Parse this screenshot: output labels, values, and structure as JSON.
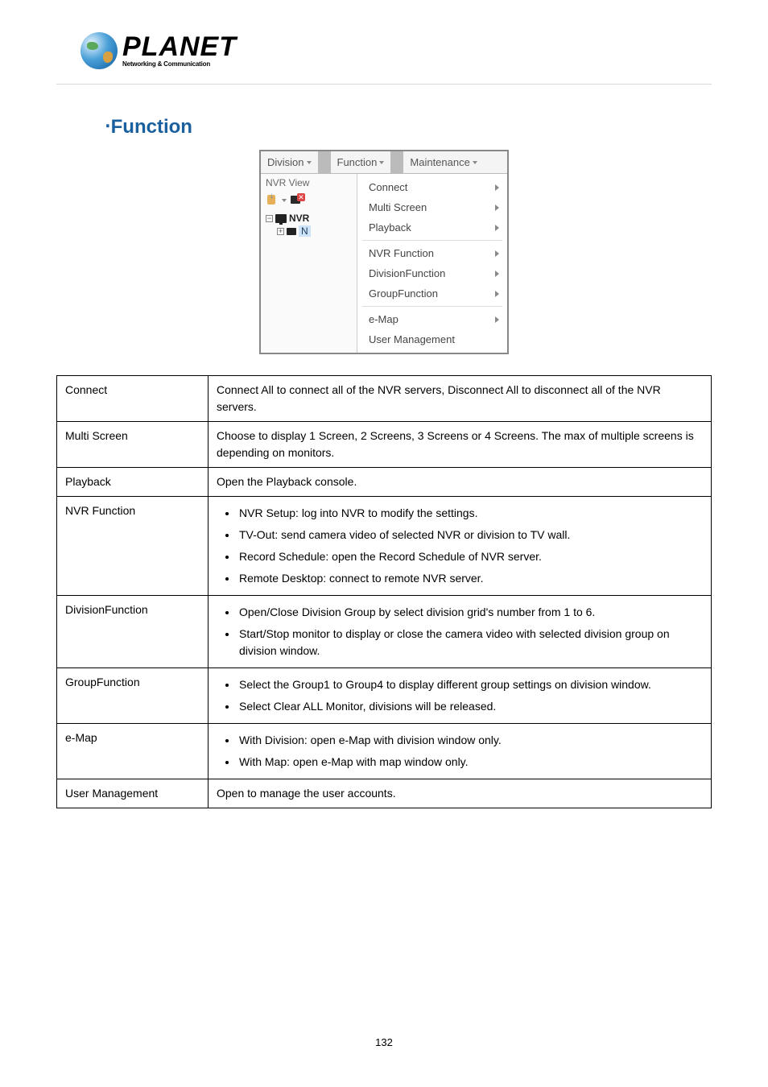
{
  "logo": {
    "brand": "PLANET",
    "tagline": "Networking & Communication"
  },
  "section_title": "‧Function",
  "screenshot": {
    "menubar": {
      "division": "Division",
      "function": "Function",
      "maintenance": "Maintenance"
    },
    "sidebar": {
      "view_label": "NVR View",
      "nvr_root": "NVR",
      "nvr_child_prefix": "N"
    },
    "menu": {
      "connect": "Connect",
      "multi_screen": "Multi Screen",
      "playback": "Playback",
      "nvr_function": "NVR Function",
      "division_function": "DivisionFunction",
      "group_function": "GroupFunction",
      "emap": "e-Map",
      "user_management": "User Management"
    }
  },
  "table": {
    "rows": [
      {
        "label": "Connect",
        "desc": "Connect All to connect all of the NVR servers, Disconnect All to disconnect all of the NVR servers.",
        "list": null
      },
      {
        "label": "Multi Screen",
        "desc": "Choose to display 1 Screen, 2 Screens, 3 Screens or 4 Screens. The max of multiple screens is depending on monitors.",
        "list": null
      },
      {
        "label": "Playback",
        "desc": "Open the Playback console.",
        "list": null
      },
      {
        "label": "NVR Function",
        "desc": null,
        "list": [
          "NVR Setup: log into NVR to modify the settings.",
          "TV-Out: send camera video of selected NVR or division to TV wall.",
          "Record Schedule: open the Record Schedule of NVR server.",
          "Remote Desktop: connect to remote NVR server."
        ]
      },
      {
        "label": "DivisionFunction",
        "desc": null,
        "list": [
          "Open/Close Division Group by select division grid's number from 1 to 6.",
          "Start/Stop monitor to display or close the camera video with selected division group on division window."
        ]
      },
      {
        "label": "GroupFunction",
        "desc": null,
        "list": [
          "Select the Group1 to Group4 to display different group settings on division window.",
          "Select Clear ALL Monitor, divisions will be released."
        ]
      },
      {
        "label": "e-Map",
        "desc": null,
        "list": [
          "With Division: open e-Map with division window only.",
          "With Map: open e-Map with map window only."
        ]
      },
      {
        "label": "User Management",
        "desc": "Open to manage the user accounts.",
        "list": null
      }
    ]
  },
  "page_number": "132"
}
